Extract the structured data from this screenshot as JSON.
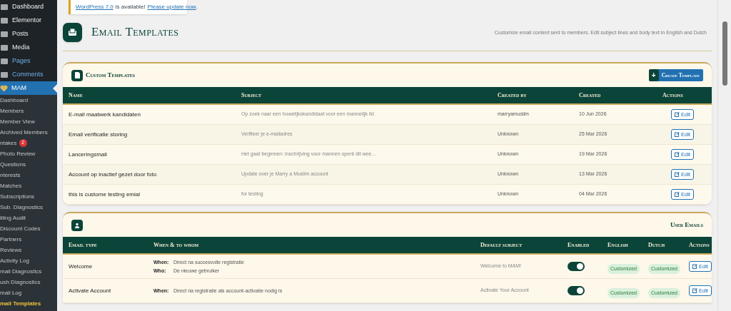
{
  "sidebar": {
    "items": [
      {
        "label": "Dashboard",
        "highlighted": false
      },
      {
        "label": "Elementor",
        "highlighted": false
      },
      {
        "label": "Posts",
        "highlighted": false
      },
      {
        "label": "Media",
        "highlighted": false
      },
      {
        "label": "Pages",
        "highlighted": true
      },
      {
        "label": "Comments",
        "highlighted": true
      },
      {
        "label": "MAM",
        "selected": true,
        "children": [
          {
            "label": "Dashboard",
            "selected": false
          },
          {
            "label": "Members",
            "selected": false
          },
          {
            "label": "Member View",
            "selected": false
          },
          {
            "label": "Archived Members",
            "selected": false
          },
          {
            "label": "ntakes",
            "selected": false,
            "badge": "2"
          },
          {
            "label": "Photo Review",
            "selected": false
          },
          {
            "label": "Questions",
            "selected": false
          },
          {
            "label": "nterests",
            "selected": false
          },
          {
            "label": "Matches",
            "selected": false
          },
          {
            "label": "Subscriptions",
            "selected": false
          },
          {
            "label": "Sub. Diagnostics",
            "selected": false
          },
          {
            "label": "illing Audit",
            "selected": false
          },
          {
            "label": "Discount Codes",
            "selected": false
          },
          {
            "label": "Partners",
            "selected": false
          },
          {
            "label": "Reviews",
            "selected": false
          },
          {
            "label": "Activity Log",
            "selected": false
          },
          {
            "label": "mail Diagnostics",
            "selected": false
          },
          {
            "label": "ush Diagnostics",
            "selected": false
          },
          {
            "label": "mail Log",
            "selected": false
          },
          {
            "label": "mail Templates",
            "selected": true
          }
        ]
      }
    ]
  },
  "notice": {
    "link_1": "WordPress 7.0",
    "text": "is available!",
    "link_2": "Please update now",
    "end": "."
  },
  "header": {
    "title": "Email Templates",
    "description": "Customize email content sent to members. Edit subject lines and body text in English and Dutch"
  },
  "custom_templates": {
    "title": "Custom Templates",
    "button": "Create Template",
    "button_icon": "+",
    "columns": [
      "Name",
      "Subject",
      "Created by",
      "Created",
      "Actions"
    ],
    "rows": [
      {
        "name": "E-mail maatwerk kandidaten",
        "subject": "Op zoek naar een huwelijkskandidaat voor een mannelijk lid",
        "created_by": "marryamuslim",
        "created": "10 Jun 2026",
        "action": "Edit"
      },
      {
        "name": "Email verificatie storing",
        "subject": "Verifieer je e-mailadres",
        "created_by": "Unknown",
        "created": "25 Mar 2026",
        "action": "Edit"
      },
      {
        "name": "Lanceringsmail",
        "subject": "Het gaat beginnen: inschrijving voor mannen opent dit wee...",
        "created_by": "Unknown",
        "created": "19 Mar 2026",
        "action": "Edit"
      },
      {
        "name": "Account op inactief gezet door foto",
        "subject": "Update over je Marry a Muslim account",
        "created_by": "Unknown",
        "created": "13 Mar 2026",
        "action": "Edit"
      },
      {
        "name": "this is custome testing emial",
        "subject": "for testing",
        "created_by": "Unknown",
        "created": "04 Mar 2026",
        "action": "Edit"
      }
    ]
  },
  "user_emails": {
    "title": "User Emails",
    "columns": [
      "Email type",
      "When & to whom",
      "Default subject",
      "Enabled",
      "English",
      "Dutch",
      "Actions"
    ],
    "rows": [
      {
        "type": "Welcome",
        "when_label": "When:",
        "when": "Direct na succesvolle registratie",
        "who_label": "Who:",
        "who": "De nieuwe gebruiker",
        "subject": "Welcome to MAM!",
        "enabled": true,
        "english": "Customized",
        "dutch": "Customized",
        "action": "Edit"
      },
      {
        "type": "Activate Account",
        "when_label": "When:",
        "when": "Direct na registratie als account-activatie nodig is",
        "subject": "Activate Your Account",
        "enabled": true,
        "english": "Customized",
        "dutch": "Customized",
        "action": "Edit"
      }
    ]
  }
}
